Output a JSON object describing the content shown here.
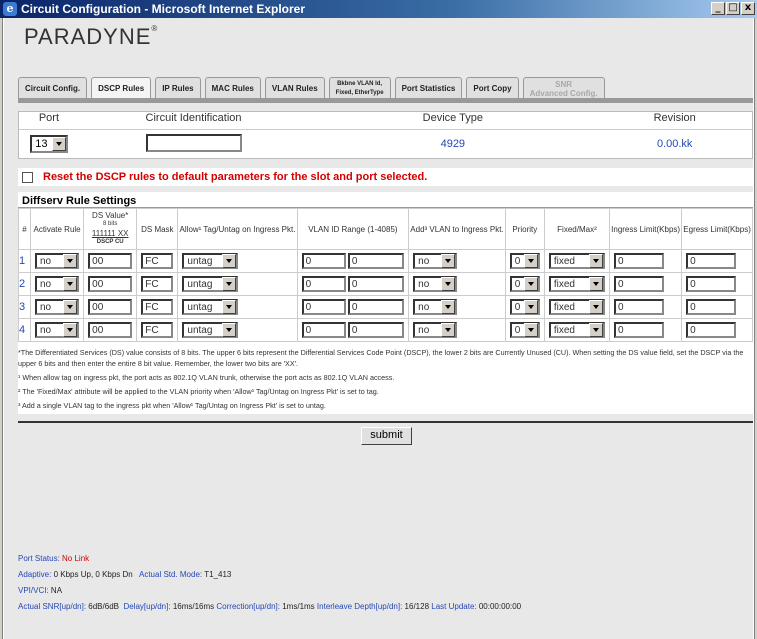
{
  "window": {
    "title": "Circuit Configuration - Microsoft Internet Explorer",
    "min": "_",
    "max": "□",
    "close": "x"
  },
  "logo": "PARADYNE",
  "tabs": [
    {
      "label": "Circuit Config."
    },
    {
      "label": "DSCP Rules"
    },
    {
      "label": "IP Rules"
    },
    {
      "label": "MAC Rules"
    },
    {
      "label": "VLAN Rules"
    },
    {
      "label": "Bkbne VLAN Id,\nFixed, EtherType"
    },
    {
      "label": "Port Statistics"
    },
    {
      "label": "Port Copy"
    },
    {
      "label": "SNR\nAdvanced Config."
    }
  ],
  "port_table": {
    "headers": [
      "Port",
      "Circuit Identification",
      "Device Type",
      "Revision"
    ],
    "port_value": "13",
    "circuit_id": "",
    "device_type": "4929",
    "revision": "0.00.kk"
  },
  "reset_label": "Reset the DSCP rules to default parameters for the slot and port selected.",
  "diffserv": {
    "title": "Diffserv Rule Settings",
    "headers": {
      "num": "#",
      "activate": "Activate Rule",
      "ds_value": "DS Value*",
      "ds_bits": "8 bits",
      "ds_sample": "111111 XX",
      "ds_sub": "DSCP   CU",
      "ds_mask": "DS Mask",
      "allow": "Allow¹ Tag/Untag on Ingress Pkt.",
      "vlan_range": "VLAN ID Range (1-4085)",
      "add_vlan": "Add³ VLAN to Ingress Pkt.",
      "priority": "Priority",
      "fixed_max": "Fixed/Max²",
      "ingress": "Ingress Limit(Kbps)",
      "egress": "Egress Limit(Kbps)"
    },
    "rows": [
      {
        "num": "1",
        "activate": "no",
        "ds": "00",
        "mask": "FC",
        "allow": "untag",
        "vlan_from": "0",
        "vlan_to": "0",
        "add": "no",
        "priority": "0",
        "fixed": "fixed",
        "ingress": "0",
        "egress": "0"
      },
      {
        "num": "2",
        "activate": "no",
        "ds": "00",
        "mask": "FC",
        "allow": "untag",
        "vlan_from": "0",
        "vlan_to": "0",
        "add": "no",
        "priority": "0",
        "fixed": "fixed",
        "ingress": "0",
        "egress": "0"
      },
      {
        "num": "3",
        "activate": "no",
        "ds": "00",
        "mask": "FC",
        "allow": "untag",
        "vlan_from": "0",
        "vlan_to": "0",
        "add": "no",
        "priority": "0",
        "fixed": "fixed",
        "ingress": "0",
        "egress": "0"
      },
      {
        "num": "4",
        "activate": "no",
        "ds": "00",
        "mask": "FC",
        "allow": "untag",
        "vlan_from": "0",
        "vlan_to": "0",
        "add": "no",
        "priority": "0",
        "fixed": "fixed",
        "ingress": "0",
        "egress": "0"
      }
    ]
  },
  "notes": [
    "*The Differentiated Services (DS) value consists of 8 bits. The upper 6 bits represent the Differential Services Code Point (DSCP), the lower 2 bits are Currently Unused (CU). When setting the DS value field, set the DSCP via the upper 6 bits and then enter the entire 8 bit value. Remember, the lower two bits are 'XX'.",
    "¹ When allow tag on ingress pkt, the port acts as 802.1Q VLAN trunk, otherwise the port acts as 802.1Q VLAN access.",
    "² The 'Fixed/Max' attribute will be applied to the VLAN priority when 'Allow¹ Tag/Untag on Ingress Pkt' is set to tag.",
    "³ Add a single VLAN tag to the ingress pkt when 'Allow¹ Tag/Untag on Ingress Pkt' is set to untag."
  ],
  "submit_label": "submit",
  "status": {
    "port_status_label": "Port Status:",
    "port_status_value": "No Link",
    "adaptive_label": "Adaptive:",
    "adaptive_value": "0 Kbps Up, 0 Kbps Dn",
    "mode_label": "Actual Std. Mode:",
    "mode_value": "T1_413",
    "vpivci_label": "VPI/VCI:",
    "vpivci_value": "NA",
    "snr_label": "Actual SNR[up/dn]:",
    "snr_value": "6dB/6dB",
    "delay_label": "Delay[up/dn]:",
    "delay_value": "16ms/16ms",
    "correction_label": "Correction[up/dn]:",
    "correction_value": "1ms/1ms",
    "interleave_label": "Interleave Depth[up/dn]:",
    "interleave_value": "16/128",
    "update_label": "Last Update:",
    "update_value": "00:00:00:00"
  }
}
